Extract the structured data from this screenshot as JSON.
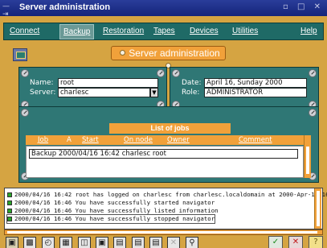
{
  "window": {
    "title": "Server administration",
    "controls": "▫ □ ✕",
    "menu_glyph": "— ⇥"
  },
  "menu": {
    "items": [
      "Connect",
      "Backup",
      "Restoration",
      "Tapes",
      "Devices",
      "Utilities",
      "Help"
    ],
    "active": "Backup"
  },
  "banner": {
    "title": "Server administration"
  },
  "info": {
    "name_label": "Name:",
    "name_value": "root",
    "server_label": "Server:",
    "server_value": "charlesc",
    "date_label": "Date:",
    "date_value": "April 16, Sunday 2000",
    "role_label": "Role:",
    "role_value": "ADMINISTRATOR"
  },
  "jobs": {
    "title": "List of jobs",
    "columns": [
      "Job",
      "A",
      "Start",
      "On node",
      "Owner",
      "Comment"
    ],
    "rows": [
      {
        "text": "Backup    2000/04/16 16:42  charlesc    root"
      }
    ]
  },
  "log": {
    "lines": [
      "2000/04/16 16:42 root has logged on charlesc from charlesc.localdomain at 2000-Apr-16 16",
      "2000/04/16 16:46 You have successfully started navigator",
      "2000/04/16 16:46 You have successfully listed information",
      "2000/04/16 16:46 You have successfully stopped navigator"
    ]
  },
  "toolbar": {
    "icons": [
      "backup-icon",
      "monitor-icon",
      "clock-icon",
      "tape-icon",
      "folder-icon",
      "device-icon",
      "server-icon",
      "panel-icon",
      "document-icon",
      "cancel-x-icon",
      "search-icon"
    ],
    "confirm_glyph": "✓",
    "cancel_glyph": "✕",
    "help_glyph": "?"
  },
  "colors": {
    "app_bg": "#d5a442",
    "panel": "#2f7775",
    "accent": "#f1a13a",
    "title_bar": "#1f2f8a"
  }
}
